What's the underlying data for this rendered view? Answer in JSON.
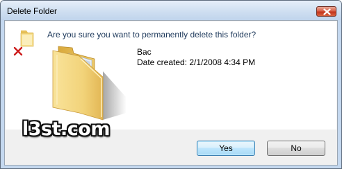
{
  "window": {
    "title": "Delete Folder",
    "close_icon": "close-icon"
  },
  "dialog": {
    "question": "Are you sure you want to permanently delete this folder?",
    "folder_name": "Bac",
    "date_created": "Date created: 2/1/2008 4:34 PM",
    "watermark": "l3st.com"
  },
  "buttons": {
    "yes_label": "Yes",
    "no_label": "No"
  },
  "icons": {
    "small": "folder-delete-icon",
    "large": "folder-icon"
  },
  "colors": {
    "question_text": "#1e395b",
    "close_button": "#c2341c",
    "delete_x": "#cc1a1a"
  }
}
